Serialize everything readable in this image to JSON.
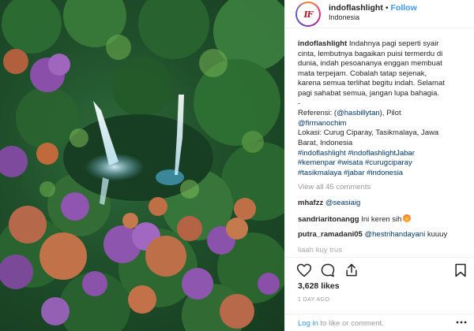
{
  "post": {
    "username": "indoflashlight",
    "follow_label": "Follow",
    "separator": "•",
    "location": "Indonesia",
    "avatar_text": "IF",
    "photo_alt": "waterfall"
  },
  "caption": {
    "author": "indoflashlight",
    "lines": [
      "Indahnya pagi seperti syair",
      "cinta, lembutnya bagaikan puisi termerdu di",
      "dunia, indah pesoananya enggan membuat",
      "mata terpejam. Cobalah tatap sejenak,",
      "karena semua terlihat begitu indah. Selamat",
      "pagi sahabat semua, jangan lupa bahagia.",
      "-"
    ],
    "referensi_label": "Referensi: (",
    "referensi_mention": "@hasbillytan",
    "referensi_rest": "), Pilot",
    "pilot_mention": "@firmanochim",
    "lokasi_line1": "Lokasi: Curug Ciparay, Tasikmalaya, Jawa",
    "lokasi_line2": "Barat, Indonesia",
    "hashtags_line1": "#indoflashlight #indoflashlightJabar",
    "hashtags_line2": "#kemenpar #wisata #curugciparay",
    "hashtags_line3": "#tasikmalaya #jabar #indonesia"
  },
  "view_all_label": "View all 45 comments",
  "comments": [
    {
      "author": "mhafzz",
      "text": "@seasiaig",
      "text_is_mention": true
    },
    {
      "author": "sandriaritonangg",
      "text": "Ini keren sih",
      "emoji": "fire-emoji"
    },
    {
      "author": "putra_ramadani05",
      "text": "@hestrihandayani kuuuy",
      "mention": "@hestrihandayani",
      "rest": " kuuuy"
    },
    {
      "author": "",
      "text": "liaah kuy trus"
    }
  ],
  "stats": {
    "likes": "3,628 likes",
    "timestamp": "1 DAY AGO"
  },
  "footer": {
    "login_link": "Log in",
    "rest": " to like or comment."
  },
  "icons": [
    "heart-icon",
    "comment-icon",
    "share-icon",
    "bookmark-icon",
    "more-options-icon"
  ],
  "colors": {
    "link_blue": "#3897f0",
    "hashtag_blue": "#003569",
    "muted_gray": "#999999",
    "text_dark": "#262626"
  }
}
